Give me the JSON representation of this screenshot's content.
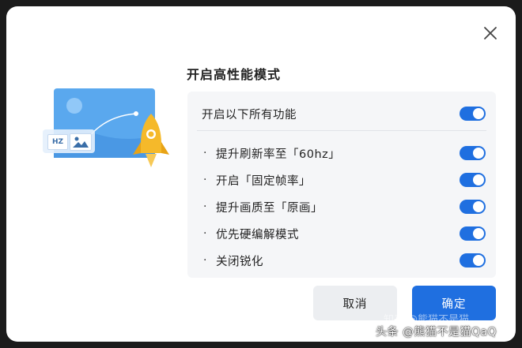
{
  "dialog": {
    "title": "开启高性能模式",
    "close_icon": "close-icon",
    "master_toggle": {
      "label": "开启以下所有功能",
      "on": true
    },
    "options": [
      {
        "bullet": "·",
        "label": "提升刷新率至「60hz」",
        "on": true
      },
      {
        "bullet": "·",
        "label": "开启「固定帧率」",
        "on": true
      },
      {
        "bullet": "·",
        "label": "提升画质至「原画」",
        "on": true
      },
      {
        "bullet": "·",
        "label": "优先硬编解模式",
        "on": true
      },
      {
        "bullet": "·",
        "label": "关闭锐化",
        "on": true
      }
    ],
    "buttons": {
      "cancel": "取消",
      "confirm": "确定"
    }
  },
  "illustration": {
    "badge_text": "HZ",
    "image_icon": "image-icon",
    "rocket_icon": "rocket-icon"
  },
  "watermark": {
    "text": "头条 @熊猫不是猫QaQ",
    "faint_text": "知乎 @熊猫不是猫"
  },
  "colors": {
    "accent": "#1f6fe0",
    "toggle_knob": "#ffffff",
    "panel_bg": "#f5f6f8",
    "cancel_bg": "#eceef1",
    "rocket": "#f5b92a"
  }
}
